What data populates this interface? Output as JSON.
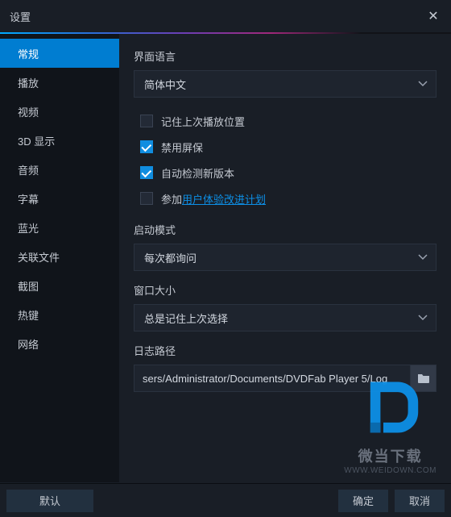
{
  "window": {
    "title": "设置"
  },
  "sidebar": {
    "items": [
      {
        "label": "常规",
        "active": true
      },
      {
        "label": "播放",
        "active": false
      },
      {
        "label": "视频",
        "active": false
      },
      {
        "label": "3D 显示",
        "active": false
      },
      {
        "label": "音频",
        "active": false
      },
      {
        "label": "字幕",
        "active": false
      },
      {
        "label": "蓝光",
        "active": false
      },
      {
        "label": "关联文件",
        "active": false
      },
      {
        "label": "截图",
        "active": false
      },
      {
        "label": "热键",
        "active": false
      },
      {
        "label": "网络",
        "active": false
      }
    ]
  },
  "general": {
    "uiLanguage": {
      "label": "界面语言",
      "value": "简体中文"
    },
    "rememberPosition": {
      "label": "记住上次播放位置",
      "checked": false
    },
    "disableScreensaver": {
      "label": "禁用屏保",
      "checked": true
    },
    "autoUpdate": {
      "label": "自动检测新版本",
      "checked": true
    },
    "uxProgram": {
      "prefix": "参加",
      "link": "用户体验改进计划",
      "checked": false
    },
    "startupMode": {
      "label": "启动模式",
      "value": "每次都询问"
    },
    "windowSize": {
      "label": "窗口大小",
      "value": "总是记住上次选择"
    },
    "logPath": {
      "label": "日志路径",
      "value": "sers/Administrator/Documents/DVDFab Player 5/Log"
    }
  },
  "footer": {
    "default": "默认",
    "ok": "确定",
    "cancel": "取消"
  },
  "watermark": {
    "text1": "微当下载",
    "text2": "WWW.WEIDOWN.COM"
  }
}
